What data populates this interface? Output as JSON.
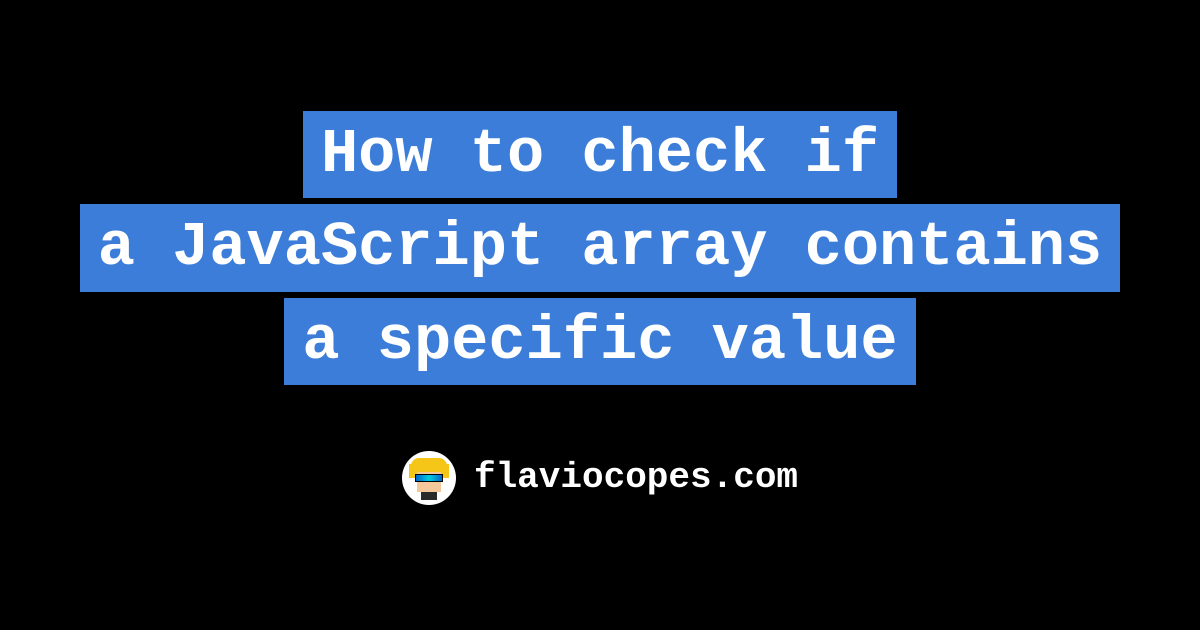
{
  "title": {
    "line1": "How to check if",
    "line2": "a JavaScript array contains",
    "line3": "a specific value"
  },
  "footer": {
    "site_name": "flaviocopes.com"
  },
  "colors": {
    "background": "#000000",
    "highlight": "#3b7dd8",
    "text": "#ffffff"
  }
}
